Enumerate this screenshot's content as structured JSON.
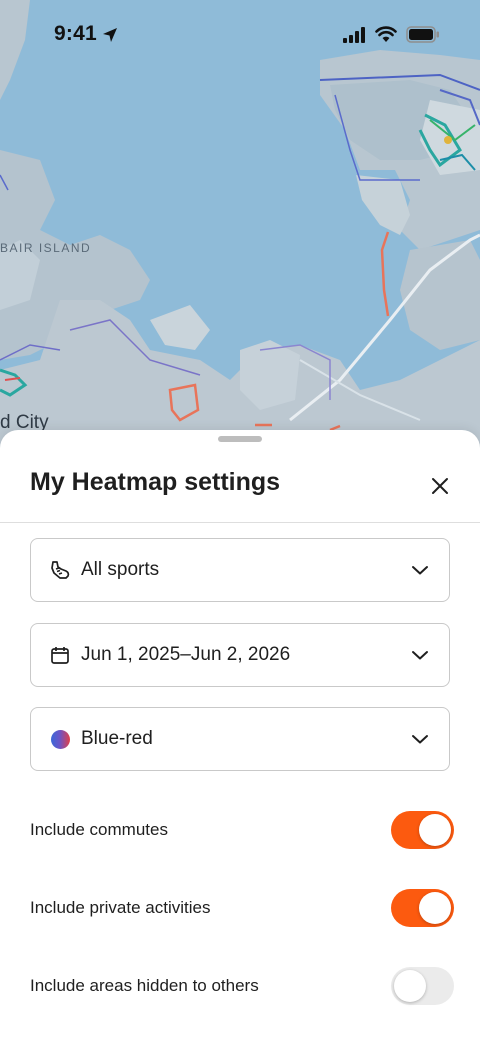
{
  "status_bar": {
    "time": "9:41",
    "icons": [
      "location-arrow-icon",
      "cellular-signal-icon",
      "wifi-icon",
      "battery-icon"
    ]
  },
  "map": {
    "labels": {
      "island": "BAIR ISLAND",
      "city": "d City"
    },
    "colors": {
      "water": "#8fbbd8",
      "land": "#bcc9d2",
      "heat_route": "#e8745a",
      "heat_cluster": "#2aa7a0"
    }
  },
  "sheet": {
    "title": "My Heatmap settings",
    "close_icon": "close-icon",
    "filters": {
      "sport": {
        "label": "All sports",
        "icon": "shoe-icon"
      },
      "date_range": {
        "label": "Jun 1, 2025–Jun 2, 2026",
        "icon": "calendar-icon"
      },
      "color": {
        "label": "Blue-red",
        "icon": "gradient-swatch-icon"
      }
    },
    "toggles": [
      {
        "label": "Include commutes",
        "on": true
      },
      {
        "label": "Include private activities",
        "on": true
      },
      {
        "label": "Include areas hidden to others",
        "on": false
      }
    ]
  },
  "colors": {
    "accent": "#fc5a0f",
    "toggle_off": "#ebebeb",
    "text": "#1f1f1f"
  }
}
